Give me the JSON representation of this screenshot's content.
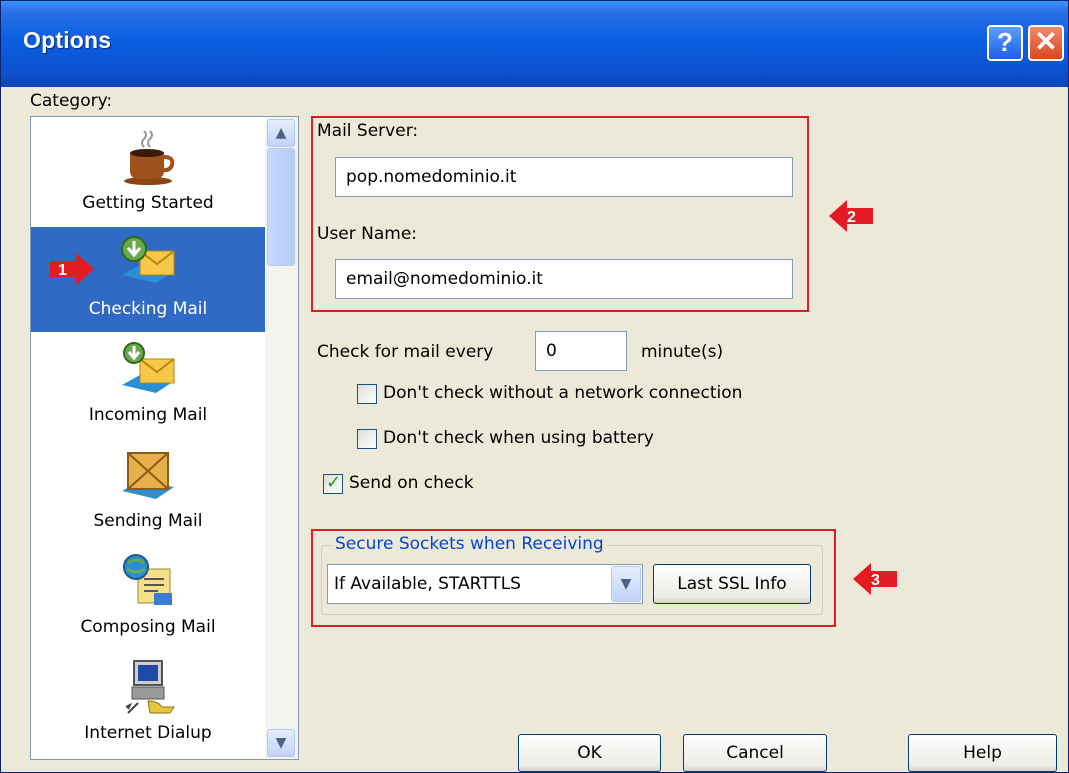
{
  "window": {
    "title": "Options"
  },
  "category_label": "Category:",
  "categories": [
    {
      "label": "Getting Started",
      "icon": "coffee-cup-icon"
    },
    {
      "label": "Checking Mail",
      "icon": "checking-mail-icon",
      "selected": true
    },
    {
      "label": "Incoming Mail",
      "icon": "incoming-mail-icon"
    },
    {
      "label": "Sending Mail",
      "icon": "sending-mail-icon"
    },
    {
      "label": "Composing Mail",
      "icon": "composing-mail-icon"
    },
    {
      "label": "Internet Dialup",
      "icon": "internet-dialup-icon"
    }
  ],
  "mail_server": {
    "label": "Mail Server:",
    "value": "pop.nomedominio.it"
  },
  "user_name": {
    "label": "User Name:",
    "value": "email@nomedominio.it"
  },
  "check_interval": {
    "prefix": "Check for mail every",
    "value": "0",
    "suffix": "minute(s)"
  },
  "options": [
    {
      "label": "Don't check without a network connection",
      "checked": false
    },
    {
      "label": "Don't check when using battery",
      "checked": false
    },
    {
      "label": "Send on check",
      "checked": true
    }
  ],
  "ssl": {
    "group_label": "Secure Sockets when Receiving",
    "selected": "If Available, STARTTLS",
    "info_button": "Last SSL Info"
  },
  "buttons": {
    "ok": "OK",
    "cancel": "Cancel",
    "help": "Help"
  },
  "annotations": [
    "1",
    "2",
    "3"
  ],
  "colors": {
    "annotation": "#e41b23",
    "selection": "#316ac5",
    "titlebar": "#0a5fe0",
    "group_label": "#0046d5"
  }
}
